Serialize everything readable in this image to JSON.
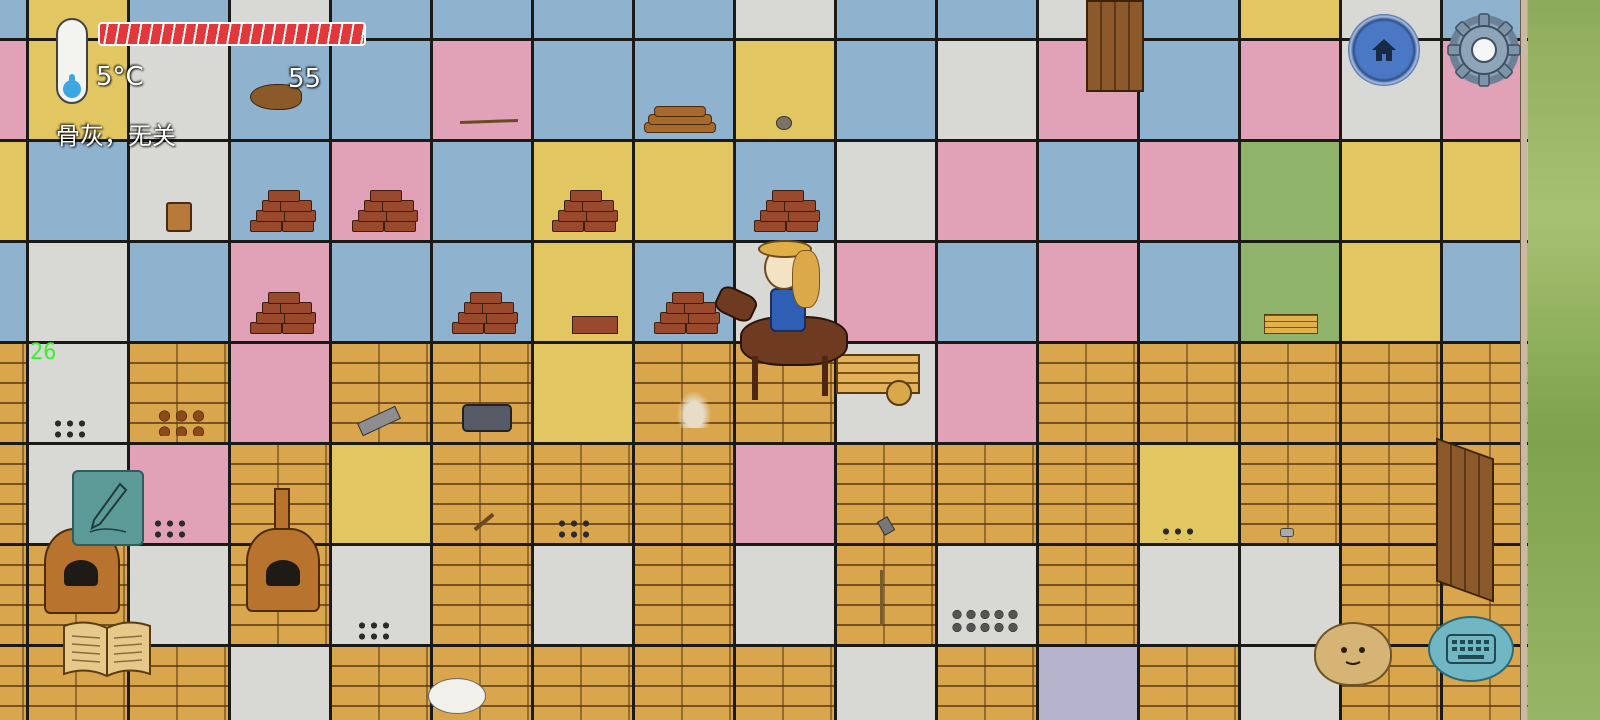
{
  "hud": {
    "temperature": "5°C",
    "age": "55",
    "status": "骨灰，无关",
    "fps": "26",
    "food_fraction": 1.0,
    "thermometer_fraction": 0.3
  },
  "buttons": {
    "home": "home-icon",
    "settings": "gear-icon",
    "note": "pencil-icon",
    "recipe_book": "book-icon",
    "emote": "emote-face-icon",
    "keyboard": "keyboard-icon"
  },
  "colors": {
    "food_bar": "#e2383b",
    "fps_text": "#39f02e",
    "home_button": "#4a78c5",
    "note_button": "#5b9a96"
  },
  "scene": {
    "player": "rider-on-horse-with-cart",
    "objects": [
      "adobe-brick-stack",
      "firewood-pile",
      "clay-bucket",
      "kiln",
      "charcoal-pile",
      "ink-bottle",
      "stone-chunk",
      "hammer",
      "stake",
      "boards"
    ]
  }
}
